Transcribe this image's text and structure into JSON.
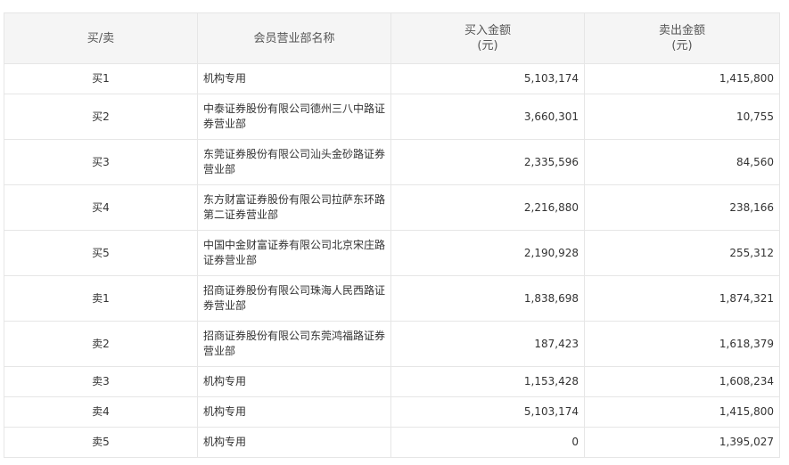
{
  "table": {
    "headers": {
      "side": "买/卖",
      "member": "会员营业部名称",
      "buy_line1": "买入金额",
      "buy_line2": "(元)",
      "sell_line1": "卖出金额",
      "sell_line2": "(元)"
    },
    "rows": [
      {
        "side": "买1",
        "name": "机构专用",
        "buy": "5,103,174",
        "sell": "1,415,800"
      },
      {
        "side": "买2",
        "name": "中泰证券股份有限公司德州三八中路证券营业部",
        "buy": "3,660,301",
        "sell": "10,755"
      },
      {
        "side": "买3",
        "name": "东莞证券股份有限公司汕头金砂路证券营业部",
        "buy": "2,335,596",
        "sell": "84,560"
      },
      {
        "side": "买4",
        "name": "东方财富证券股份有限公司拉萨东环路第二证券营业部",
        "buy": "2,216,880",
        "sell": "238,166"
      },
      {
        "side": "买5",
        "name": "中国中金财富证券有限公司北京宋庄路证券营业部",
        "buy": "2,190,928",
        "sell": "255,312"
      },
      {
        "side": "卖1",
        "name": "招商证券股份有限公司珠海人民西路证券营业部",
        "buy": "1,838,698",
        "sell": "1,874,321"
      },
      {
        "side": "卖2",
        "name": "招商证券股份有限公司东莞鸿福路证券营业部",
        "buy": "187,423",
        "sell": "1,618,379"
      },
      {
        "side": "卖3",
        "name": "机构专用",
        "buy": "1,153,428",
        "sell": "1,608,234"
      },
      {
        "side": "卖4",
        "name": "机构专用",
        "buy": "5,103,174",
        "sell": "1,415,800"
      },
      {
        "side": "卖5",
        "name": "机构专用",
        "buy": "0",
        "sell": "1,395,027"
      }
    ]
  }
}
